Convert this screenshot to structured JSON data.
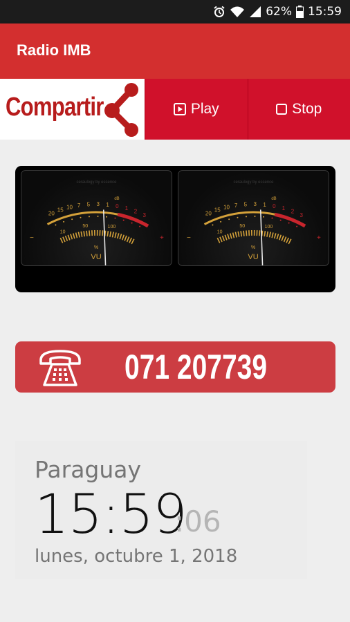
{
  "status_bar": {
    "battery": "62%",
    "time": "15:59",
    "icons": [
      "alarm-icon",
      "wifi-icon",
      "signal-icon",
      "battery-icon"
    ]
  },
  "app_bar": {
    "title": "Radio IMB"
  },
  "actions": {
    "share_label": "Compartir",
    "play_label": "Play",
    "stop_label": "Stop"
  },
  "vu_meter": {
    "scale_labels": [
      "20",
      "15",
      "10",
      "7",
      "5",
      "3",
      "1",
      "0",
      "1",
      "2",
      "3"
    ],
    "db_label": "dB",
    "lower_labels": [
      "10",
      "50",
      "100"
    ],
    "percent_label": "%",
    "vu_label": "VU",
    "minus_sign": "−",
    "plus_sign": "+",
    "maker": "ceraulogy by essence"
  },
  "phone": {
    "number": "071 207739"
  },
  "clock": {
    "timezone": "Paraguay",
    "time": "15:59",
    "separator": ":",
    "seconds": "06",
    "date": "lunes, octubre 1, 2018"
  },
  "colors": {
    "app_bar": "#d32f2f",
    "action_buttons": "#d0112b",
    "share_text": "#b71c1c",
    "phone_bar": "#cc3d42",
    "vu_amber": "#d4a13a",
    "vu_red": "#c8252d"
  }
}
